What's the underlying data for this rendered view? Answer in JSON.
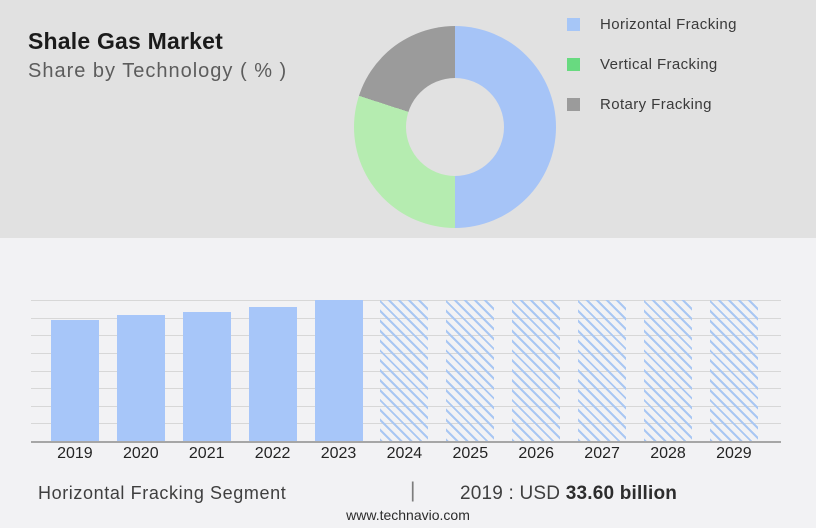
{
  "header": {
    "title": "Shale Gas Market",
    "subtitle": "Share by Technology ( % )"
  },
  "legend": {
    "items": [
      {
        "label": "Horizontal Fracking",
        "color": "#a6c6f7"
      },
      {
        "label": "Vertical Fracking",
        "color": "#68da80"
      },
      {
        "label": "Rotary Fracking",
        "color": "#9b9b9b"
      }
    ]
  },
  "colors": {
    "top_panel_bg": "#e1e1e1",
    "bottom_panel_bg": "#f2f2f4",
    "gridline": "#d7d7d7",
    "axis_line": "#a6a6a6"
  },
  "chart_data": [
    {
      "type": "pie",
      "title": "Share by Technology ( % )",
      "labels": [
        "Horizontal Fracking",
        "Vertical Fracking",
        "Rotary Fracking"
      ],
      "values": [
        50,
        30,
        20
      ],
      "colors": [
        "#a6c4f7",
        "#b5ecb0",
        "#9b9b9b"
      ],
      "donut": true,
      "inner_radius_pct": 48,
      "start_angle_deg": 0,
      "clockwise": true,
      "legend_position": "right"
    },
    {
      "type": "bar",
      "categories": [
        "2019",
        "2020",
        "2021",
        "2022",
        "2023",
        "2024",
        "2025",
        "2026",
        "2027",
        "2028",
        "2029"
      ],
      "values_gridline_units": [
        6.85,
        7.15,
        7.3,
        7.6,
        8,
        8,
        8,
        8,
        8,
        8,
        8
      ],
      "hatched": [
        false,
        false,
        false,
        false,
        false,
        true,
        true,
        true,
        true,
        true,
        true
      ],
      "ylim": [
        0,
        8
      ],
      "gridline_intervals": 8,
      "grid": true,
      "bar_color": "#a7c6f9",
      "hatch_color": "#a9c7f3",
      "note_known_value": "2019 : USD 33.60 billion",
      "xlabel": "",
      "ylabel": ""
    }
  ],
  "footer": {
    "segment_label": "Horizontal Fracking Segment",
    "separator": "|",
    "value_prefix": "2019 : USD ",
    "value_bold": "33.60 billion",
    "website": "www.technavio.com"
  }
}
